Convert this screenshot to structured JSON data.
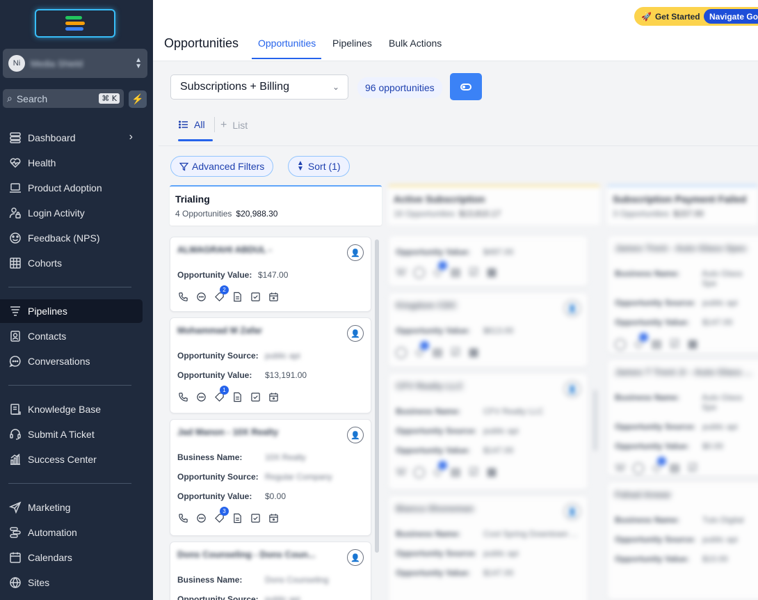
{
  "sidebar": {
    "account_initials": "Ni",
    "account_name": "Media Shield",
    "search_placeholder": "Search",
    "search_shortcut": "⌘ K",
    "items": [
      {
        "label": "Dashboard",
        "icon": "dashboard-icon"
      },
      {
        "label": "Health",
        "icon": "heart-pulse-icon"
      },
      {
        "label": "Product Adoption",
        "icon": "laptop-icon"
      },
      {
        "label": "Login Activity",
        "icon": "user-lock-icon"
      },
      {
        "label": "Feedback (NPS)",
        "icon": "feedback-icon"
      },
      {
        "label": "Cohorts",
        "icon": "table-icon"
      },
      {
        "label": "Pipelines",
        "icon": "funnel-icon"
      },
      {
        "label": "Contacts",
        "icon": "contact-icon"
      },
      {
        "label": "Conversations",
        "icon": "chat-icon"
      },
      {
        "label": "Knowledge Base",
        "icon": "book-icon"
      },
      {
        "label": "Submit A Ticket",
        "icon": "headset-icon"
      },
      {
        "label": "Success Center",
        "icon": "chart-icon"
      },
      {
        "label": "Marketing",
        "icon": "send-icon"
      },
      {
        "label": "Automation",
        "icon": "workflow-icon"
      },
      {
        "label": "Calendars",
        "icon": "calendar-icon"
      },
      {
        "label": "Sites",
        "icon": "globe-icon"
      }
    ]
  },
  "topbar": {
    "get_started": "Get Started",
    "navigate": "Navigate Go",
    "page_title": "Opportunities",
    "tabs": [
      "Opportunities",
      "Pipelines",
      "Bulk Actions"
    ]
  },
  "filters": {
    "pipeline": "Subscriptions + Billing",
    "count": "96 opportunities",
    "views": [
      "All",
      "List"
    ],
    "advanced_filters": "Advanced Filters",
    "sort": "Sort (1)"
  },
  "columns": [
    {
      "title": "Trialing",
      "count": "4 Opportunities",
      "value": "$20,988.30"
    },
    {
      "title": "Active Subscription",
      "count": "16 Opportunities",
      "value": "$13,810.17"
    },
    {
      "title": "Subscription Payment Failed",
      "count": "3 Opportunities",
      "value": "$157.00"
    }
  ],
  "labels": {
    "business_name": "Business Name:",
    "opportunity_source": "Opportunity Source:",
    "opportunity_value": "Opportunity Value:"
  },
  "trialing_cards": [
    {
      "name": "ALMAGRAHI ABDUL -",
      "value": "$147.00",
      "badge": "2"
    },
    {
      "name": "Mohammad M Zafar",
      "source": "public api",
      "value": "$13,191.00",
      "badge": "1"
    },
    {
      "name": "Jad Manon - 10X Realty",
      "business": "10X Realty",
      "source": "Regular Company",
      "value": "$0.00",
      "badge": "3"
    },
    {
      "name": "Dons Counseling - Dons Coun...",
      "business": "Dons Counseling",
      "source": "public api"
    }
  ],
  "active_cards": [
    {
      "value": "$497.00"
    },
    {
      "name": "Kingdom CDC",
      "value": "$613.00"
    },
    {
      "name": "CFV Realty LLC",
      "business": "CFV Realty LLC",
      "source": "public api",
      "value": "$147.00"
    },
    {
      "name": "Bianca Shoneman",
      "business": "Cool Spring Downtown ...",
      "source": "public api",
      "value": "$147.00"
    }
  ],
  "failed_cards": [
    {
      "name": "James Trent - Auto Glass Spec",
      "business": "Auto Glass Spe",
      "source": "public api",
      "value": "$147.00"
    },
    {
      "name": "James T Trent Jr - Auto Glass ...",
      "business": "Auto Glass Spe",
      "source": "public api",
      "value": "$0.00"
    },
    {
      "name": "Fahad Anwar",
      "business": "Tulo Digital",
      "source": "public api",
      "value": "$10.00"
    }
  ]
}
